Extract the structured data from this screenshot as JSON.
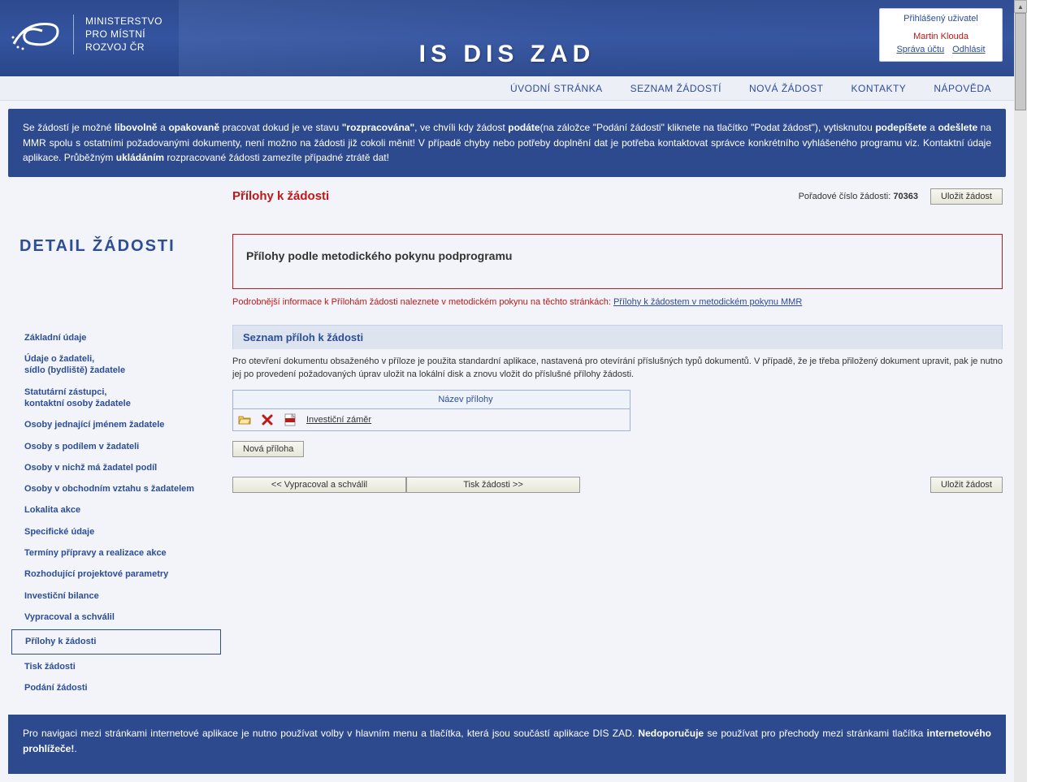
{
  "header": {
    "ministry_line1": "MINISTERSTVO",
    "ministry_line2": "PRO MÍSTNÍ",
    "ministry_line3": "ROZVOJ ČR",
    "app_title": "IS DIS ZAD"
  },
  "user_box": {
    "title": "Přihlášený uživatel",
    "name": "Martin Klouda",
    "account_link": "Správa účtu",
    "logout_link": "Odhlásit"
  },
  "top_nav": [
    "ÚVODNÍ STRÁNKA",
    "SEZNAM ŽÁDOSTÍ",
    "NOVÁ ŽÁDOST",
    "KONTAKTY",
    "NÁPOVĚDA"
  ],
  "info_banner": {
    "p1a": "Se žádostí je možné ",
    "p1b": "libovolně",
    "p1c": " a ",
    "p1d": "opakovaně",
    "p1e": " pracovat dokud je ve stavu ",
    "p1f": "\"rozpracována\"",
    "p1g": ", ve chvíli kdy žádost ",
    "p1h": "podáte",
    "p1i": "(na záložce \"Podání žádosti\" kliknete na tlačítko \"Podat žádost\"), vytisknutou ",
    "p1j": "podepíšete",
    "p1k": " a ",
    "p1l": "odešlete",
    "p1m": " na MMR spolu s ostatními požadovanými dokumenty, není možno na žádosti již cokoli měnit! V případě chyby nebo potřeby doplnění dat je potřeba kontaktovat správce konkrétního vyhlášeného programu viz. Kontaktní údaje aplikace. Průběžným ",
    "p1n": "ukládáním",
    "p1o": " rozpracované žádosti zamezíte případné ztrátě dat!"
  },
  "detail_title": "DETAIL ŽÁDOSTI",
  "side_menu": [
    "Základní údaje",
    "Údaje o žadateli,\nsídlo (bydliště) žadatele",
    "Statutární zástupci,\nkontaktní osoby žadatele",
    "Osoby jednající jménem žadatele",
    "Osoby s podílem v žadateli",
    "Osoby v nichž má žadatel podíl",
    "Osoby v obchodním vztahu s žadatelem",
    "Lokalita akce",
    "Specifické údaje",
    "Termíny přípravy a realizace akce",
    "Rozhodující projektové parametry",
    "Investiční bilance",
    "Vypracoval a schválil",
    "Přílohy k žádosti",
    "Tisk žádosti",
    "Podání žádosti"
  ],
  "side_menu_active_index": 13,
  "page": {
    "title": "Přílohy k žádosti",
    "order_label": "Pořadové číslo žádosti: ",
    "order_number": "70363",
    "save_button": "Uložit žádost",
    "red_box_title": "Přílohy podle metodického pokynu podprogramu",
    "red_note_text": "Podrobnější informace k Přílohám žádosti naleznete v metodickém pokynu na těchto stránkách: ",
    "red_note_link": "Přílohy k žádostem v metodickém pokynu MMR",
    "section_header": "Seznam příloh k žádosti",
    "section_desc": "Pro otevření dokumentu obsaženého v příloze je použita standardní aplikace, nastavená pro otevírání příslušných typů dokumentů. V případě, že je třeba přiložený dokument upravit, pak je nutno jej po provedení požadovaných úprav uložit na lokální disk a znovu vložit do příslušné přílohy žádosti.",
    "table_header": "Název přílohy",
    "attachments": [
      {
        "name": "Investiční záměr"
      }
    ],
    "new_attachment_button": "Nová příloha",
    "prev_button": "<<  Vypracoval a schválil",
    "print_button": "Tisk žádosti  >>",
    "save_button_bottom": "Uložit žádost"
  },
  "footer": {
    "t1": "Pro navigaci mezi stránkami internetové aplikace je nutno používat volby v hlavním menu a tlačítka, která jsou součástí aplikace DIS ZAD. ",
    "t2": "Nedoporučuje",
    "t3": " se používat pro přechody mezi stránkami tlačítka ",
    "t4": "internetového prohlížeče!",
    "t5": "."
  }
}
